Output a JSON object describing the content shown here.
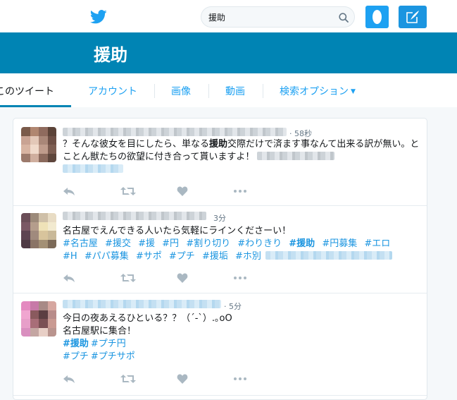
{
  "search": {
    "value": "援助",
    "placeholder": ""
  },
  "header": {
    "title": "援助"
  },
  "tabs": [
    {
      "label": "このツイート"
    },
    {
      "label": "アカウント"
    },
    {
      "label": "画像"
    },
    {
      "label": "動画"
    },
    {
      "label": "検索オプション"
    }
  ],
  "colors": {
    "brand": "#1da1f2",
    "header_bg": "#0084b4",
    "link": "#1b95e0",
    "meta": "#657786"
  },
  "tweets": [
    {
      "time": "· 58秒",
      "text_before": "？そんな彼女を目にしたら、単なる",
      "highlight": "援助",
      "text_after": "交際だけで済ます事なんて出来る訳が無い。とことん獣たちの欲望に付き合って貰いますよ！"
    },
    {
      "time": "3分",
      "line1": "名古屋でえんできる人いたら気軽にラインくださーい！",
      "tags": [
        "#名古屋",
        "#援交",
        "#援",
        "#円",
        "#割り切り",
        "#わりきり",
        "#援助",
        "#円募集",
        "#エロ",
        "#H",
        "#パパ募集",
        "#サポ",
        "#プチ",
        "#援垢",
        "#ホ別"
      ]
    },
    {
      "time": "· 5分",
      "line1": "今日の夜あえるひといる？？（´-`）.｡oO",
      "line2": "名古屋駅に集合！",
      "tags_line1": [
        "#援助",
        "#プチ円"
      ],
      "tags_line2": [
        "#プチ",
        "#プチサポ"
      ]
    }
  ],
  "icons": [
    "twitter-bird-icon",
    "search-icon",
    "avatar-egg-icon",
    "compose-icon",
    "reply-icon",
    "retweet-icon",
    "like-icon",
    "more-icon",
    "chevron-down-icon"
  ]
}
